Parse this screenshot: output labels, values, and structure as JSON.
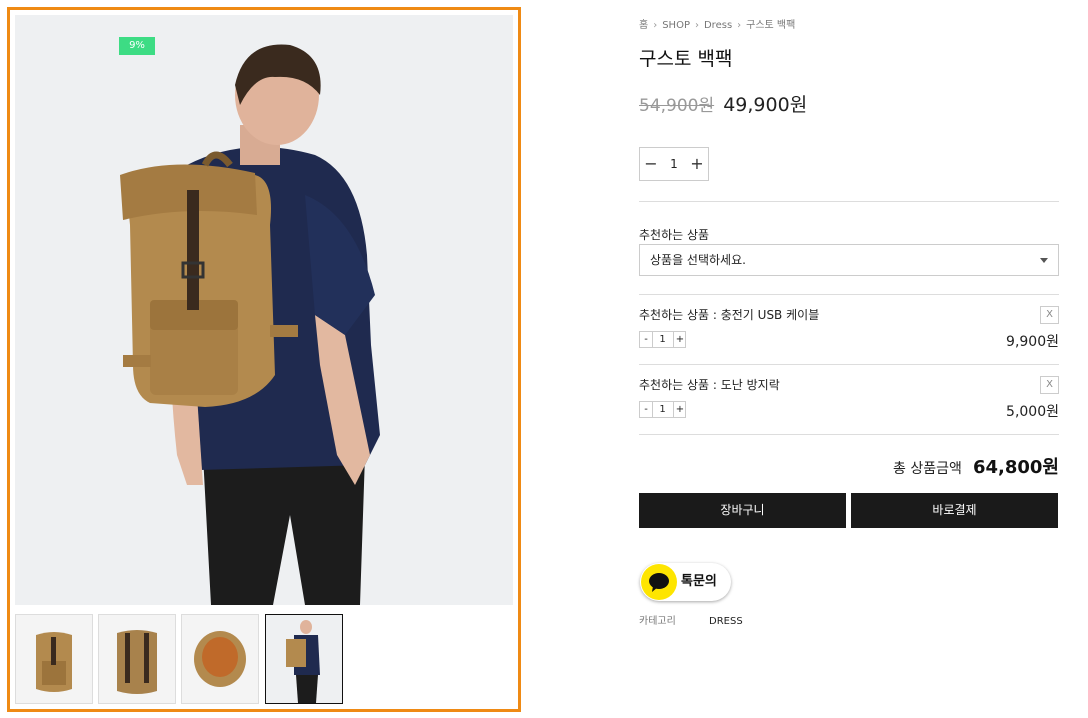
{
  "product_image": {
    "discount_badge": "9%"
  },
  "thumbnails": [
    {
      "alt": "backpack-front"
    },
    {
      "alt": "backpack-back"
    },
    {
      "alt": "backpack-top-open"
    },
    {
      "alt": "model-wearing-backpack",
      "active": true
    }
  ],
  "breadcrumb": [
    "홈",
    "SHOP",
    "Dress",
    "구스토 백팩"
  ],
  "product": {
    "title": "구스토 백팩",
    "original_price": "54,900원",
    "sale_price": "49,900원",
    "quantity": "1",
    "minus": "−",
    "plus": "+"
  },
  "recommend": {
    "label": "추천하는 상품",
    "select_placeholder": "상품을 선택하세요."
  },
  "selected_options": [
    {
      "name": "추천하는 상품 : 충전기 USB 케이블",
      "qty": "1",
      "price": "9,900원",
      "remove": "X",
      "minus": "-",
      "plus": "+"
    },
    {
      "name": "추천하는 상품 : 도난 방지락",
      "qty": "1",
      "price": "5,000원",
      "remove": "X",
      "minus": "-",
      "plus": "+"
    }
  ],
  "total": {
    "label": "총 상품금액",
    "amount": "64,800원"
  },
  "buttons": {
    "cart": "장바구니",
    "buy_now": "바로결제"
  },
  "kakao": {
    "label": "톡문의"
  },
  "meta": {
    "category_label": "카테고리",
    "category_value": "DRESS"
  },
  "colors": {
    "accent_border": "#ef8a14",
    "badge": "#3ddc84",
    "button_bg": "#1a1a1a",
    "kakao_yellow": "#fee500"
  }
}
